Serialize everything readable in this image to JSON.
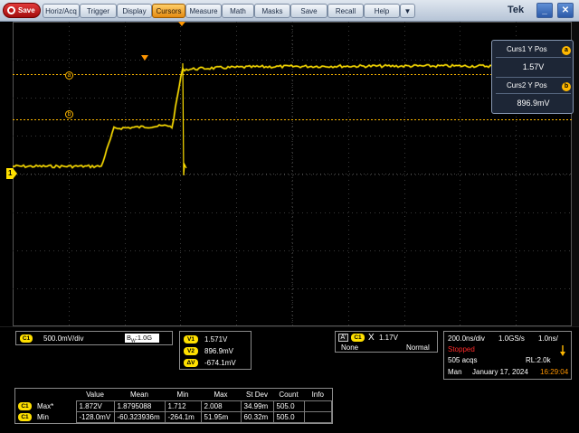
{
  "menu": {
    "save_label": "Save",
    "items": [
      "Horiz/Acq",
      "Trigger",
      "Display",
      "Cursors",
      "Measure",
      "Math",
      "Masks",
      "Save",
      "Recall",
      "Help"
    ],
    "active": "Cursors",
    "dropdown_glyph": "▼",
    "brand": "Tek",
    "minimize_glyph": "_",
    "close_glyph": "✕"
  },
  "screen": {
    "channel_marker": "1",
    "cursor_a_label": "a",
    "cursor_b_label": "b"
  },
  "cursor_readout": {
    "curs1_title": "Curs1 Y Pos",
    "curs1_value": "1.57V",
    "curs1_badge": "a",
    "curs2_title": "Curs2 Y Pos",
    "curs2_value": "896.9mV",
    "curs2_badge": "b"
  },
  "channel_info": {
    "badge": "C1",
    "scale": "500.0mV/div",
    "bandwidth_prefix": "B",
    "bandwidth_sub": "W",
    "bandwidth": ":1.0G"
  },
  "voltage_cursors": {
    "v1_label": "V1",
    "v1_value": "1.571V",
    "v2_label": "V2",
    "v2_value": "896.9mV",
    "dv_label": "ΔV",
    "dv_value": "-674.1mV"
  },
  "trigger_info": {
    "a_badge": "A'",
    "channel_badge": "C1",
    "slope_glyph": "X",
    "level": "1.17V",
    "coupling": "None",
    "mode": "Normal"
  },
  "acquisition": {
    "timebase": "200.0ns/div",
    "sample_rate": "1.0GS/s",
    "resolution": "1.0ns/",
    "state": "Stopped",
    "acqs": "505 acqs",
    "record_length": "RL:2.0k",
    "date_prefix": "Man",
    "date": "January 17, 2024",
    "time": "16:29:04"
  },
  "measurements": {
    "headers": [
      "Value",
      "Mean",
      "Min",
      "Max",
      "St Dev",
      "Count",
      "Info"
    ],
    "rows": [
      {
        "badge": "C1",
        "label": "Max*",
        "values": [
          "1.872V",
          "1.8795088",
          "1.712",
          "2.008",
          "34.99m",
          "505.0",
          ""
        ]
      },
      {
        "badge": "C1",
        "label": "Min",
        "values": [
          "-128.0mV",
          "-60.323936m",
          "-264.1m",
          "51.95m",
          "60.32m",
          "505.0",
          ""
        ]
      }
    ]
  },
  "colors": {
    "trace": "#ffe000",
    "cursor": "#ffb800",
    "accent_orange": "#ff9500",
    "stopped": "#ff2a2a"
  }
}
